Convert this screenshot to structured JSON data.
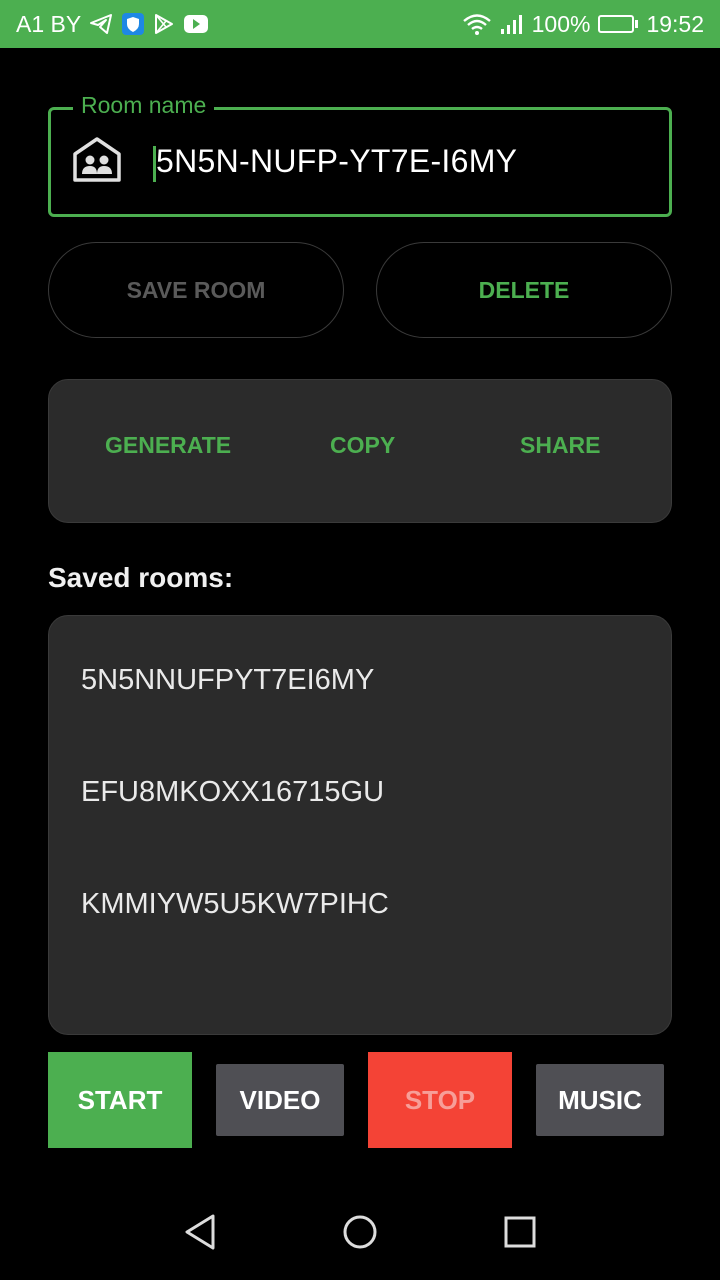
{
  "status_bar": {
    "carrier": "A1 BY",
    "battery_percent": "100%",
    "time": "19:52",
    "icons_left": [
      "telegram-icon",
      "shield-app-icon",
      "play-store-icon",
      "youtube-icon"
    ],
    "icons_right": [
      "wifi-icon",
      "signal-icon",
      "battery-icon"
    ],
    "color": "#4caf50"
  },
  "room_field": {
    "label": "Room name",
    "value": "5N5N-NUFP-YT7E-I6MY",
    "icon": "meeting-room-icon"
  },
  "buttons": {
    "save_room": "SAVE ROOM",
    "delete": "DELETE"
  },
  "actions": {
    "generate": "GENERATE",
    "copy": "COPY",
    "share": "SHARE"
  },
  "saved": {
    "heading": "Saved rooms:",
    "rooms": [
      "5N5NNUFPYT7EI6MY",
      "EFU8MKOXX16715GU",
      "KMMIYW5U5KW7PIHC"
    ]
  },
  "controls": {
    "start": "START",
    "video": "VIDEO",
    "stop": "STOP",
    "music": "MUSIC"
  },
  "colors": {
    "accent": "#4caf50",
    "stop": "#f44336",
    "surface": "#2b2b2b",
    "neutral_button": "#4f4f54"
  },
  "nav_bar": {
    "icons": [
      "back-icon",
      "home-icon",
      "recent-apps-icon"
    ]
  }
}
